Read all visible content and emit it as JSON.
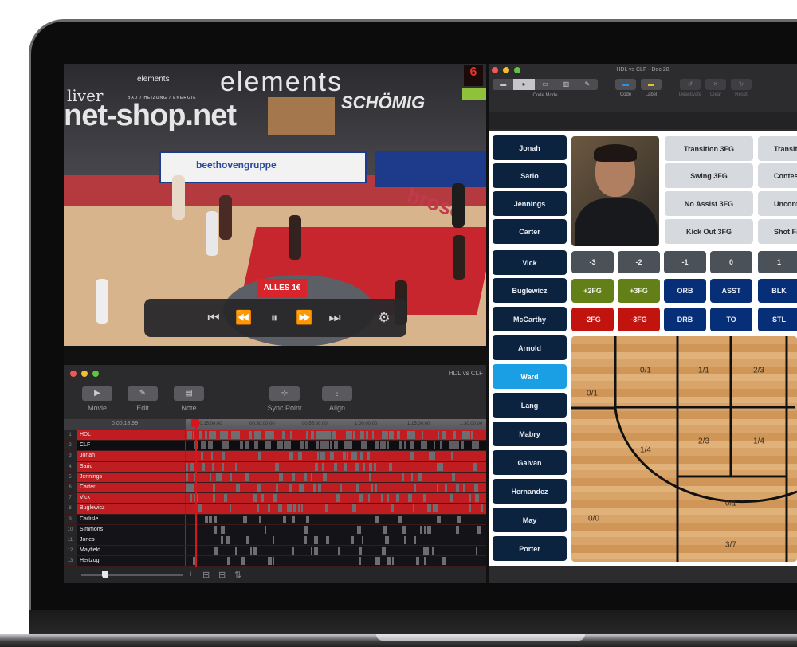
{
  "video": {
    "banners": {
      "top_brand": "elements",
      "top_brand_sub": "BAD / HEIZUNG / ENERGIE",
      "left_banner": "net-shop.net",
      "left_logo": "liver",
      "right_banner": "SCHÖMIG",
      "board1": "beethovengruppe",
      "board2": "brose",
      "center_logo": "ALLES 1€"
    },
    "shot_clock": "6",
    "controls": {
      "skip_back": "⏮",
      "rewind": "⏪",
      "pause": "⏸",
      "fast_forward": "⏩",
      "skip_forward": "⏭",
      "settings": "⚙"
    }
  },
  "timeline_window": {
    "title": "HDL vs CLF",
    "toolbar": [
      {
        "label": "Movie",
        "icon": "▶"
      },
      {
        "label": "Edit",
        "icon": "✎"
      },
      {
        "label": "Note",
        "icon": "▤"
      },
      {
        "label": "Sync Point",
        "icon": "⊹"
      },
      {
        "label": "Align",
        "icon": "⋮"
      }
    ],
    "current_time": "0:00:18.99",
    "ruler_ticks": [
      "00:15:00:00",
      "00:30:00:00",
      "00:55:00:00",
      "1:00:00:00",
      "1:15:00:00",
      "1:30:00:00"
    ],
    "rows": [
      {
        "num": "1",
        "name": "HDL",
        "style": "red"
      },
      {
        "num": "2",
        "name": "CLF",
        "style": "black"
      },
      {
        "num": "3",
        "name": "Jonah",
        "style": "red"
      },
      {
        "num": "4",
        "name": "Sario",
        "style": "red"
      },
      {
        "num": "5",
        "name": "Jennings",
        "style": "red"
      },
      {
        "num": "6",
        "name": "Carter",
        "style": "red"
      },
      {
        "num": "7",
        "name": "Vick",
        "style": "red"
      },
      {
        "num": "8",
        "name": "Buglewicz",
        "style": "red"
      },
      {
        "num": "9",
        "name": "Carlisle",
        "style": "dark"
      },
      {
        "num": "10",
        "name": "Simmons",
        "style": "dark"
      },
      {
        "num": "11",
        "name": "Jones",
        "style": "dark"
      },
      {
        "num": "12",
        "name": "Mayfield",
        "style": "dark"
      },
      {
        "num": "13",
        "name": "Hertzog",
        "style": "dark"
      }
    ],
    "zoom_level": 0.2,
    "footer_icons": {
      "zoom_out": "−",
      "add": "+",
      "add_row": "⊞",
      "save": "⊟",
      "sort": "⇅"
    }
  },
  "code_window": {
    "title": "HDL vs CLF - Dec 28",
    "code_mode_label": "Code Mode",
    "code_mode_segments": [
      "▬",
      "▸",
      "▭",
      "▥",
      "✎"
    ],
    "code_mode_selected": 1,
    "toolbar": [
      {
        "label": "Code",
        "icon": "▬",
        "color": "#2a8fe0",
        "enabled": true
      },
      {
        "label": "Label",
        "icon": "▬",
        "color": "#e8c21c",
        "enabled": true
      },
      {
        "label": "Deactivate",
        "icon": "↺",
        "enabled": false
      },
      {
        "label": "Clear",
        "icon": "✕",
        "enabled": false
      },
      {
        "label": "Reset",
        "icon": "↻",
        "enabled": false
      }
    ],
    "players": [
      "Jonah",
      "Sario",
      "Jennings",
      "Carter",
      "Vick",
      "Buglewicz",
      "McCarthy",
      "Arnold",
      "Ward",
      "Lang",
      "Mabry",
      "Galvan",
      "Hernandez",
      "May",
      "Porter"
    ],
    "active_player": "Ward",
    "play_buttons_col1": [
      "Transition 3FG",
      "Swing 3FG",
      "No Assist 3FG",
      "Kick Out 3FG"
    ],
    "play_buttons_col2": [
      "Transition",
      "Contested",
      "Uncontested",
      "Shot Fake"
    ],
    "rating_buttons": [
      "-3",
      "-2",
      "-1",
      "0",
      "1"
    ],
    "stat_row1": [
      {
        "label": "+2FG",
        "kind": "green"
      },
      {
        "label": "+3FG",
        "kind": "green"
      },
      {
        "label": "ORB",
        "kind": "blue"
      },
      {
        "label": "ASST",
        "kind": "blue"
      },
      {
        "label": "BLK",
        "kind": "blue"
      }
    ],
    "stat_row2": [
      {
        "label": "-2FG",
        "kind": "redb"
      },
      {
        "label": "-3FG",
        "kind": "redb"
      },
      {
        "label": "DRB",
        "kind": "blue"
      },
      {
        "label": "TO",
        "kind": "blue"
      },
      {
        "label": "STL",
        "kind": "blue"
      }
    ],
    "court_zones": [
      {
        "id": "left-corner-three",
        "value": "0/1"
      },
      {
        "id": "left-wing-three-top",
        "value": "0/1"
      },
      {
        "id": "top-key-three-left",
        "value": "1/1"
      },
      {
        "id": "top-key-three-right",
        "value": "2/3"
      },
      {
        "id": "left-wing-mid",
        "value": "1/4"
      },
      {
        "id": "elbow-left",
        "value": "2/3"
      },
      {
        "id": "elbow-right",
        "value": "1/4"
      },
      {
        "id": "left-baseline-three",
        "value": "0/0"
      },
      {
        "id": "paint-top",
        "value": "0/1"
      },
      {
        "id": "paint-restricted",
        "value": "3/7"
      }
    ]
  },
  "colors": {
    "player_button": "#0c2340",
    "player_active": "#1a9ee4",
    "made_green": "#638018",
    "missed_red": "#c2140f",
    "stat_blue": "#072f78",
    "timeline_red": "#bf1d22"
  }
}
